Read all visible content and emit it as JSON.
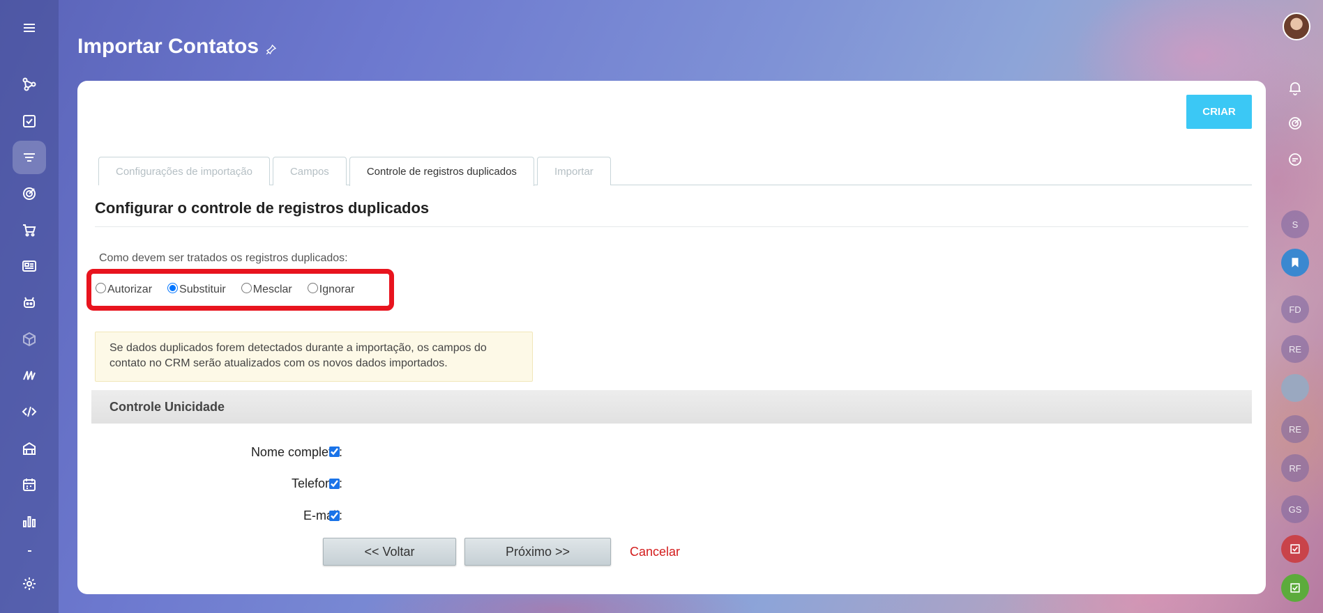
{
  "page": {
    "title": "Importar Contatos"
  },
  "header": {
    "create_button": "CRIAR"
  },
  "tabs": [
    {
      "label": "Configurações de importação",
      "state": "disabled"
    },
    {
      "label": "Campos",
      "state": "disabled"
    },
    {
      "label": "Controle de registros duplicados",
      "state": "active"
    },
    {
      "label": "Importar",
      "state": "disabled"
    }
  ],
  "section": {
    "title": "Configurar o controle de registros duplicados",
    "question": "Como devem ser tratados os registros duplicados:",
    "options": [
      "Autorizar",
      "Substituir",
      "Mesclar",
      "Ignorar"
    ],
    "selected": "Substituir",
    "notice": "Se dados duplicados forem detectados durante a importação, os campos do contato no CRM serão atualizados com os novos dados importados."
  },
  "uniqueness": {
    "title": "Controle Unicidade",
    "fields": [
      {
        "label": "Nome completo:",
        "checked": true
      },
      {
        "label": "Telefone:",
        "checked": true
      },
      {
        "label": "E-mail:",
        "checked": true
      }
    ]
  },
  "actions": {
    "back": "<< Voltar",
    "next": "Próximo >>",
    "cancel": "Cancelar"
  },
  "right_rail": {
    "avatars": [
      "S",
      "FD",
      "RE",
      "RE",
      "RF",
      "GS"
    ]
  },
  "colors": {
    "accent": "#3bc8f5",
    "highlight_border": "#e8141e",
    "cancel": "#d31c1c"
  }
}
